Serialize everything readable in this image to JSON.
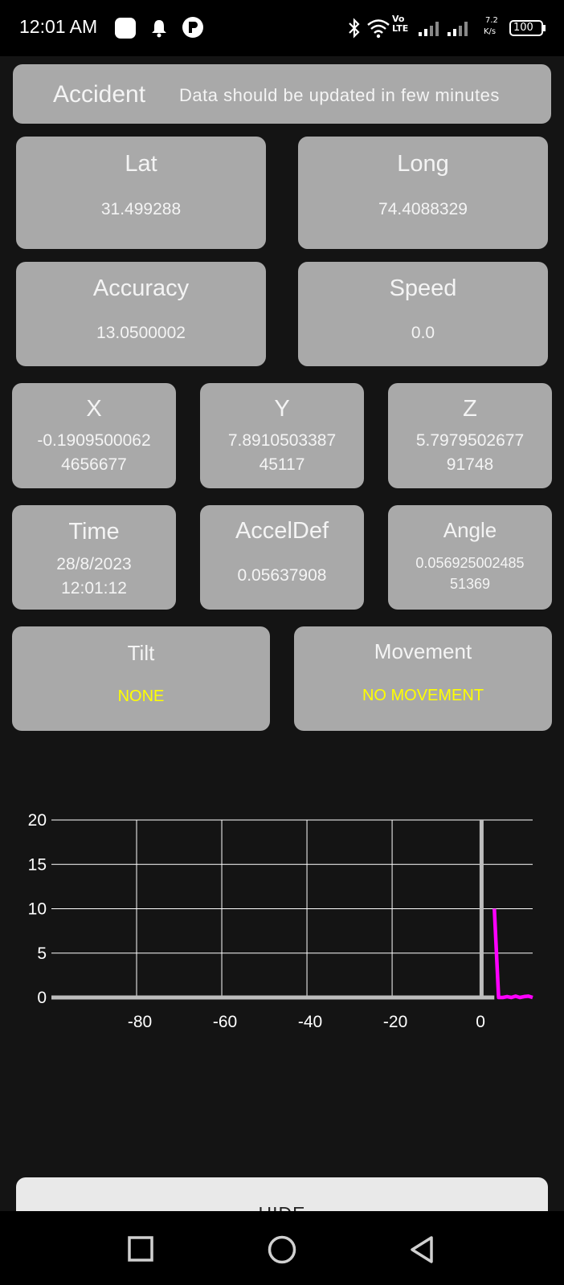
{
  "status": {
    "time": "12:01 AM",
    "network_label": "Vo LTE",
    "speed_value": "7.2",
    "speed_unit": "K/s",
    "battery": "100"
  },
  "header": {
    "title": "Accident",
    "message": "Data should be updated in few minutes"
  },
  "cards": {
    "lat": {
      "label": "Lat",
      "value": "31.499288"
    },
    "long": {
      "label": "Long",
      "value": "74.4088329"
    },
    "accuracy": {
      "label": "Accuracy",
      "value": "13.0500002"
    },
    "speed": {
      "label": "Speed",
      "value": "0.0"
    },
    "x": {
      "label": "X",
      "value_line1": "-0.1909500062",
      "value_line2": "4656677"
    },
    "y": {
      "label": "Y",
      "value_line1": "7.8910503387",
      "value_line2": "45117"
    },
    "z": {
      "label": "Z",
      "value_line1": "5.7979502677",
      "value_line2": "91748"
    },
    "time": {
      "label": "Time",
      "value_line1": "28/8/2023",
      "value_line2": "12:01:12"
    },
    "acceldef": {
      "label": "AccelDef",
      "value": "0.05637908"
    },
    "angle": {
      "label": "Angle",
      "value_line1": "0.056925002485",
      "value_line2": "51369"
    },
    "tilt": {
      "label": "Tilt",
      "value": "NONE"
    },
    "movement": {
      "label": "Movement",
      "value": "NO MOVEMENT"
    }
  },
  "chart_data": {
    "type": "line",
    "x_ticks": [
      "-80",
      "-60",
      "-40",
      "-20",
      "0"
    ],
    "y_ticks": [
      "0",
      "5",
      "10",
      "15",
      "20"
    ],
    "xlim": [
      -100,
      13
    ],
    "ylim": [
      0,
      20
    ],
    "grid": true,
    "series": [
      {
        "color": "#ff00ff",
        "x": [
          4,
          5,
          6,
          7,
          8,
          9,
          10,
          11,
          12,
          13
        ],
        "y": [
          10,
          0,
          0,
          0.1,
          0,
          0.15,
          0,
          0.1,
          0.15,
          0
        ]
      }
    ],
    "baseline_color": "#bdbdbd",
    "marker_line_x": 1
  },
  "buttons": {
    "hide": "HIDE"
  },
  "colors": {
    "card_bg": "#a9a9a9",
    "value_highlight": "#ffff00",
    "app_bg": "#141414"
  }
}
